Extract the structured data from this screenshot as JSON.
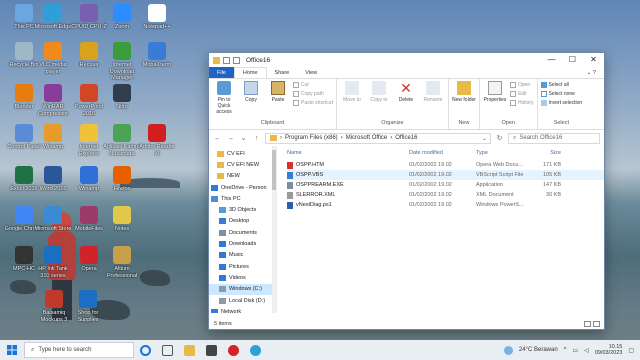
{
  "desktop_icons": [
    {
      "label": "This PC",
      "color": "#6aa7e0"
    },
    {
      "label": "Microsoft Edge",
      "color": "#2e9fd8"
    },
    {
      "label": "CPUID CPU-Z",
      "color": "#7a5fb0"
    },
    {
      "label": "Zoom",
      "color": "#2d8cff"
    },
    {
      "label": "Notepad++",
      "color": "#ffffff"
    },
    {
      "label": "Recycle Bin",
      "color": "#9fb8c8"
    },
    {
      "label": "VLC media player",
      "color": "#f08a1c"
    },
    {
      "label": "Recuva",
      "color": "#d9a21d"
    },
    {
      "label": "Internet Download Manager",
      "color": "#3a9d3a"
    },
    {
      "label": "MobaXterm",
      "color": "#3b7bd8"
    },
    {
      "label": "Blender",
      "color": "#e87d0d"
    },
    {
      "label": "WinRAR Compressor",
      "color": "#8a3c9a"
    },
    {
      "label": "PowerPoint 2016",
      "color": "#d24625"
    },
    {
      "label": "Nitro",
      "color": "#2f3d4c"
    },
    {
      "label": "Control Panel",
      "color": "#5b8bd6"
    },
    {
      "label": "Winamp",
      "color": "#e89b2a"
    },
    {
      "label": "Internet Explorer",
      "color": "#f0c23a"
    },
    {
      "label": "Aplikasi Kamus Nusantara",
      "color": "#4ba356"
    },
    {
      "label": "Adobe Reader XI",
      "color": "#d21e1e"
    },
    {
      "label": "Excel 2016",
      "color": "#1f7244"
    },
    {
      "label": "Word 2016",
      "color": "#2b579a"
    },
    {
      "label": "Winamp",
      "color": "#2e6fd8"
    },
    {
      "label": "Firefox",
      "color": "#e66000"
    },
    {
      "label": "Google Chrome",
      "color": "#4285f4"
    },
    {
      "label": "Microsoft Store",
      "color": "#3a8ad6"
    },
    {
      "label": "MobileFiles",
      "color": "#9c3a6a"
    },
    {
      "label": "Notes",
      "color": "#e2c84a"
    },
    {
      "label": "MPC-HC",
      "color": "#333333"
    },
    {
      "label": "HP Ink Tank 310 series",
      "color": "#1b6fc2"
    },
    {
      "label": "Opera",
      "color": "#d2232a"
    },
    {
      "label": "Altium Professional",
      "color": "#c7a04a"
    },
    {
      "label": "Balsamiq Mockups 3",
      "color": "#c0392b"
    },
    {
      "label": "Shop for Supplies",
      "color": "#1b6fc2"
    }
  ],
  "window": {
    "title": "Office16",
    "controls": {
      "minimize": "—",
      "maximize": "☐",
      "close": "✕"
    },
    "tabs": [
      "File",
      "Home",
      "Share",
      "View"
    ],
    "ribbon": {
      "clipboard": {
        "name": "Clipboard",
        "pin": "Pin to Quick access",
        "copy": "Copy",
        "paste": "Paste",
        "cut": "Cut",
        "copy_path": "Copy path",
        "paste_shortcut": "Paste shortcut"
      },
      "organize": {
        "name": "Organize",
        "move_to": "Move to",
        "copy_to": "Copy to",
        "delete": "Delete",
        "rename": "Rename"
      },
      "new": {
        "name": "New",
        "new_folder": "New folder"
      },
      "open": {
        "name": "Open",
        "properties": "Properties",
        "open": "Open",
        "edit": "Edit",
        "history": "History"
      },
      "select": {
        "name": "Select",
        "select_all": "Select all",
        "select_none": "Select none",
        "invert": "Invert selection"
      }
    },
    "address": {
      "path": [
        "Program Files (x86)",
        "Microsoft Office",
        "Office16"
      ],
      "search_placeholder": "Search Office16"
    },
    "nav": [
      {
        "label": "CV EFI",
        "icon": "folder"
      },
      {
        "label": "CV EFI NEW",
        "icon": "folder"
      },
      {
        "label": "NEW",
        "icon": "folder"
      },
      {
        "label": "OneDrive - Person",
        "icon": "cloud"
      },
      {
        "label": "This PC",
        "icon": "pc"
      },
      {
        "label": "3D Objects",
        "icon": "cube"
      },
      {
        "label": "Desktop",
        "icon": "desktop"
      },
      {
        "label": "Documents",
        "icon": "doc"
      },
      {
        "label": "Downloads",
        "icon": "download"
      },
      {
        "label": "Music",
        "icon": "music"
      },
      {
        "label": "Pictures",
        "icon": "picture"
      },
      {
        "label": "Videos",
        "icon": "video"
      },
      {
        "label": "Windows (C:)",
        "icon": "drive",
        "selected": true
      },
      {
        "label": "Local Disk (D:)",
        "icon": "drive"
      },
      {
        "label": "Network",
        "icon": "network"
      }
    ],
    "columns": {
      "name": "Name",
      "date": "Date modified",
      "type": "Type",
      "size": "Size"
    },
    "files": [
      {
        "name": "OSPP.HTM",
        "date": "01/02/2002 19.02",
        "type": "Opera Web Docu...",
        "size": "171 KB",
        "icon": "#d6322b"
      },
      {
        "name": "OSPP.VBS",
        "date": "01/02/2002 19.02",
        "type": "VBScript Script File",
        "size": "105 KB",
        "icon": "#3a7bd5",
        "hover": true
      },
      {
        "name": "OSPPREARM.EXE",
        "date": "01/02/2002 19.02",
        "type": "Application",
        "size": "147 KB",
        "icon": "#7f8c99"
      },
      {
        "name": "SLERROR.XML",
        "date": "01/02/2002 19.02",
        "type": "XML Document",
        "size": "30 KB",
        "icon": "#999999"
      },
      {
        "name": "vNextDiag.ps1",
        "date": "01/02/2002 19.02",
        "type": "Windows PowerS...",
        "size": "",
        "icon": "#2d5ea8"
      }
    ],
    "status": "5 items"
  },
  "taskbar": {
    "search_placeholder": "Type here to search",
    "weather": "24°C  Berawan",
    "time": "10.15",
    "date": "09/03/2023"
  }
}
